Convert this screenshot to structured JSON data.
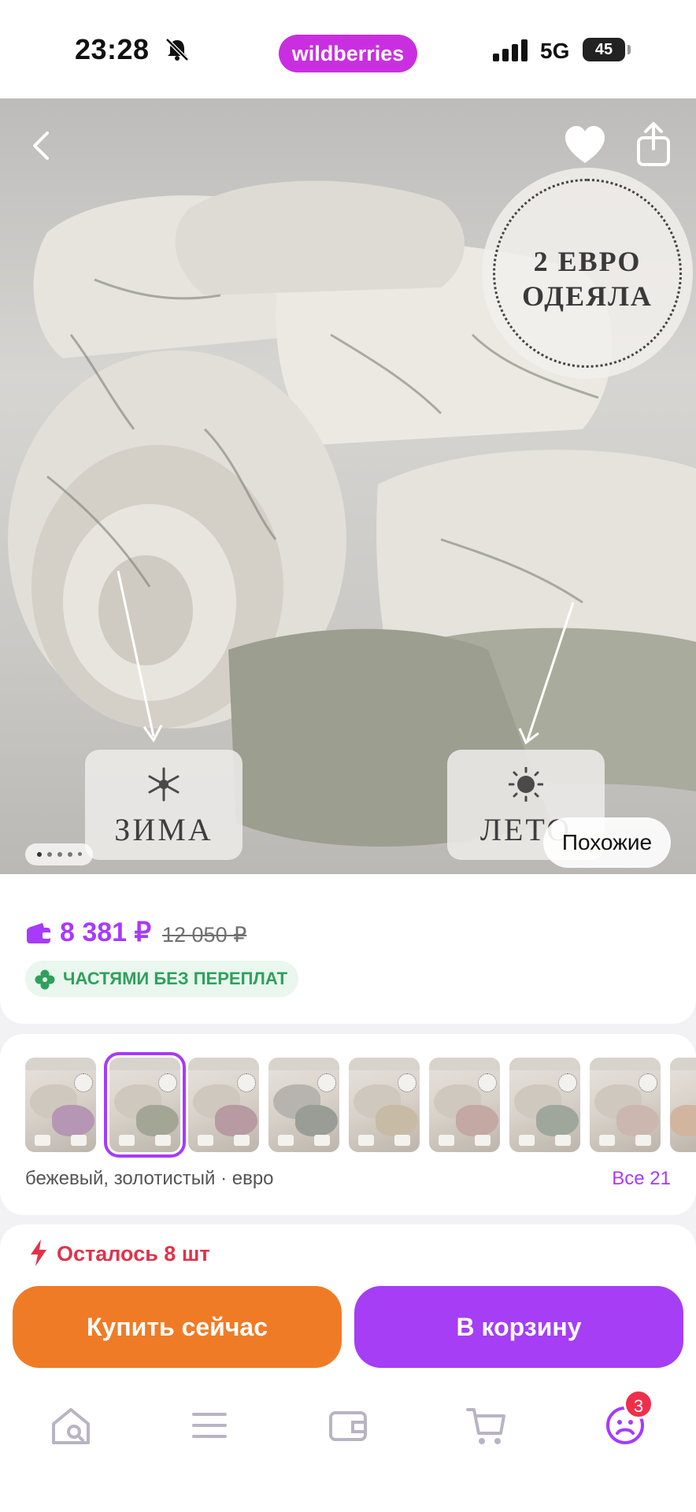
{
  "status_bar": {
    "time": "23:28",
    "brand": "wildberries",
    "network": "5G",
    "battery": "45"
  },
  "hero": {
    "badge_line1": "2 ЕВРО",
    "badge_line2": "ОДЕЯЛА",
    "season_winter": "ЗИМА",
    "season_summer": "ЛЕТО",
    "similar_label": "Похожие",
    "image_count": 5,
    "current_image": 1
  },
  "price": {
    "current": "8 381 ₽",
    "old": "12 050 ₽",
    "installment": "ЧАСТЯМИ БЕЗ ПЕРЕПЛАТ"
  },
  "variants": {
    "description": "бежевый, золотистый · евро",
    "all_label": "Все 21",
    "selected_index": 1
  },
  "stock": {
    "text": "Осталось 8 шт"
  },
  "actions": {
    "buy_now": "Купить сейчас",
    "add_to_cart": "В корзину"
  },
  "bottom_nav": {
    "items": [
      "home-search-icon",
      "menu-icon",
      "wallet-icon",
      "cart-icon",
      "profile-icon"
    ],
    "profile_badge": "3"
  },
  "colors": {
    "accent": "#a73afd",
    "buy": "#f07b26",
    "cart": "#a53ef5",
    "brand": "#c92fe0",
    "stock": "#e0334a",
    "installment": "#2fa05a"
  }
}
